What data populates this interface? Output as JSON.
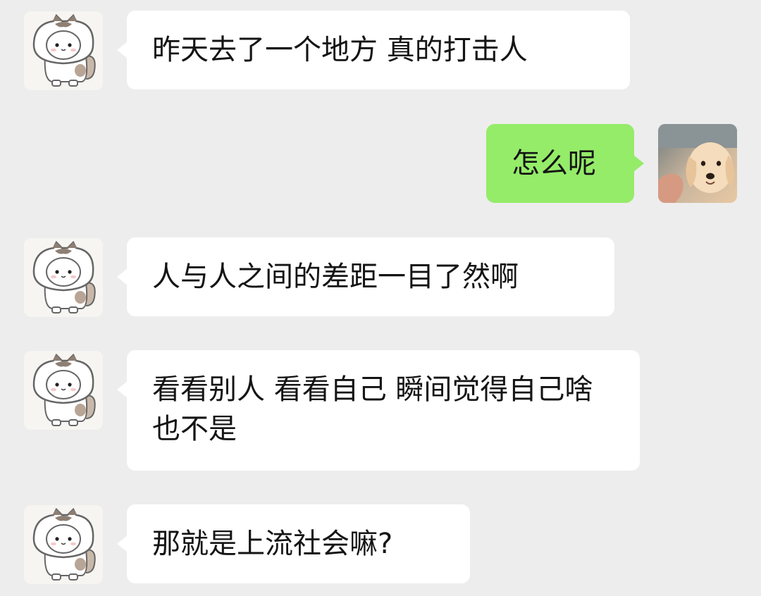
{
  "chat": {
    "messages": [
      {
        "side": "incoming",
        "avatar": "cat-hoodie-avatar",
        "text": "昨天去了一个地方  真的打击人"
      },
      {
        "side": "outgoing",
        "avatar": "puppy-photo-avatar",
        "text": "怎么呢"
      },
      {
        "side": "incoming",
        "avatar": "cat-hoodie-avatar",
        "text": "人与人之间的差距一目了然啊"
      },
      {
        "side": "incoming",
        "avatar": "cat-hoodie-avatar",
        "text": "看看别人 看看自己  瞬间觉得自己啥也不是"
      },
      {
        "side": "incoming",
        "avatar": "cat-hoodie-avatar",
        "text": "那就是上流社会嘛?"
      }
    ]
  },
  "colors": {
    "background": "#ededed",
    "incoming_bubble": "#ffffff",
    "outgoing_bubble": "#95ec69",
    "text": "#141414"
  }
}
